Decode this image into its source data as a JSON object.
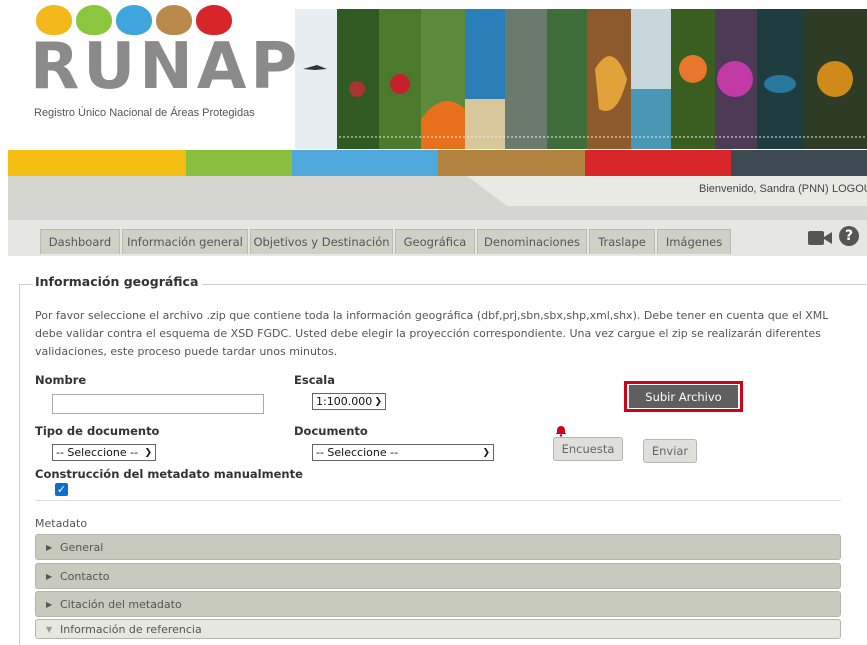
{
  "header": {
    "logo_text": "RUNAP",
    "logo_subtitle": "Registro Único Nacional de Áreas Protegidas",
    "color_bars": [
      "#f4bd12",
      "#8bbf3f",
      "#4fa8dc",
      "#b2823f",
      "#d8262b",
      "#3e4a52"
    ]
  },
  "user_bar": {
    "welcome": "Bienvenido, Sandra (PNN)",
    "logout": "LOGOUT"
  },
  "tabs": [
    {
      "label": "Dashboard"
    },
    {
      "label": "Información general"
    },
    {
      "label": "Objetivos y Destinación"
    },
    {
      "label": "Geográfica"
    },
    {
      "label": "Denominaciones"
    },
    {
      "label": "Traslape"
    },
    {
      "label": "Imágenes"
    }
  ],
  "section": {
    "title": "Información geográfica",
    "intro": "Por favor seleccione el archivo .zip que contiene toda la información geográfica (dbf,prj,sbn,sbx,shp,xml,shx). Debe tener en cuenta que el XML debe validar contra el esquema de XSD FGDC. Usted debe elegir la proyección correspondiente. Una vez cargue el zip se realizarán diferentes validaciones, este proceso puede tardar unos minutos."
  },
  "form": {
    "nombre_label": "Nombre",
    "nombre_value": "",
    "escala_label": "Escala",
    "escala_value": "1:100.000",
    "tipo_documento_label": "Tipo de documento",
    "tipo_documento_value": "-- Seleccione --",
    "documento_label": "Documento",
    "documento_value": "-- Seleccione --",
    "construccion_label": "Construcción del metadato manualmente",
    "construccion_checked": true,
    "upload_button": "Subir Archivo",
    "encuesta_button": "Encuesta",
    "enviar_button": "Enviar"
  },
  "metadata": {
    "label": "Metadato",
    "sections": [
      {
        "label": "General",
        "expanded": false
      },
      {
        "label": "Contacto",
        "expanded": false
      },
      {
        "label": "Citación del metadato",
        "expanded": false
      },
      {
        "label": "Información de referencia",
        "expanded": true
      }
    ]
  }
}
